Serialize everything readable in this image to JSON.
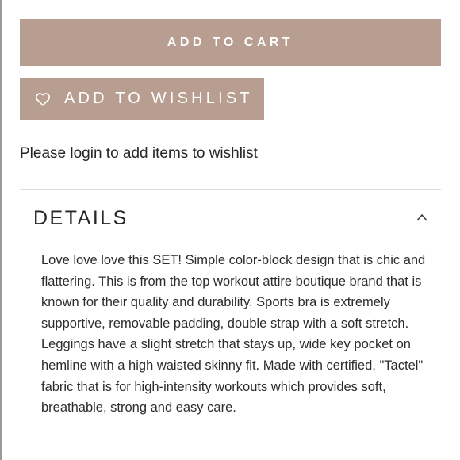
{
  "add_to_cart": {
    "label": "ADD TO CART"
  },
  "wishlist": {
    "label": "ADD TO WISHLIST",
    "icon": "heart-icon"
  },
  "login_message": "Please login to add items to wishlist",
  "details": {
    "title": "DETAILS",
    "toggle_icon": "chevron-up-icon",
    "expanded": true,
    "description": "Love love love this SET! Simple color-block design that is chic and flattering. This is from the top workout attire boutique brand that is known for their quality and durability. Sports bra is extremely supportive, removable padding, double strap with a soft stretch. Leggings have a slight stretch that stays up, wide key pocket on hemline with a high waisted skinny fit. Made with certified, \"Tactel\" fabric that is for high-intensity workouts which provides soft, breathable, strong and easy care."
  },
  "colors": {
    "button_bg": "#b89e90",
    "button_text": "#ffffff",
    "text": "#222222",
    "divider": "#dddddd"
  }
}
